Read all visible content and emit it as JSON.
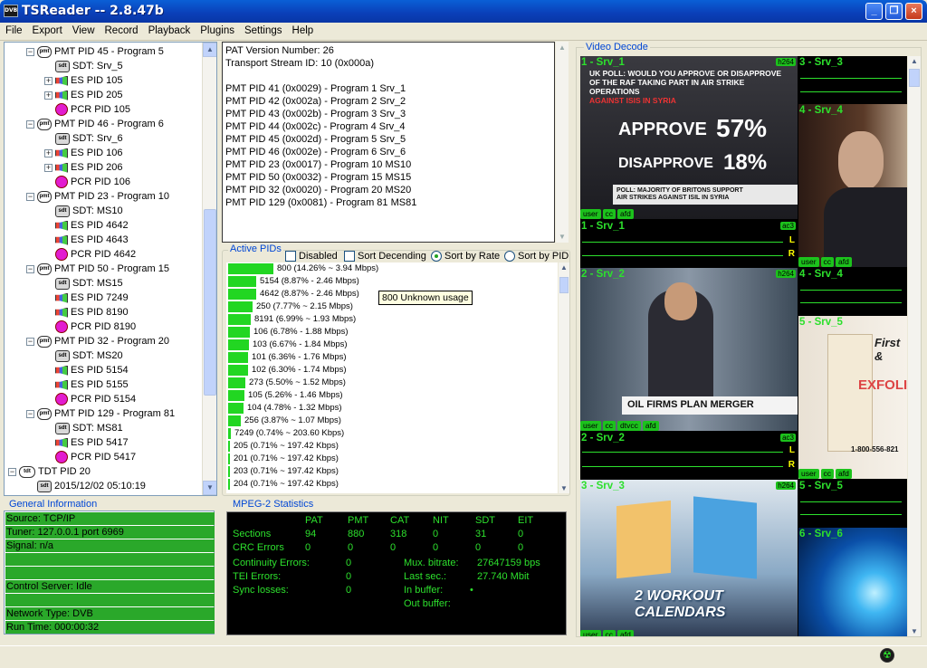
{
  "window": {
    "title": "TSReader -- 2.8.47b",
    "icon_text": "DVB",
    "minimize": "_",
    "maximize": "❐",
    "close": "×"
  },
  "menu": [
    "File",
    "Export",
    "View",
    "Record",
    "Playback",
    "Plugins",
    "Settings",
    "Help"
  ],
  "tree": [
    {
      "label": "PMT PID 45 - Program 5",
      "kind": "pmt",
      "level": 1
    },
    {
      "label": "SDT: Srv_5",
      "kind": "sdt",
      "level": 2
    },
    {
      "label": "ES PID 105",
      "kind": "es",
      "level": 2,
      "expand": true
    },
    {
      "label": "ES PID 205",
      "kind": "es",
      "level": 2,
      "expand": true
    },
    {
      "label": "PCR PID 105",
      "kind": "pcr",
      "level": 2
    },
    {
      "label": "PMT PID 46 - Program 6",
      "kind": "pmt",
      "level": 1
    },
    {
      "label": "SDT: Srv_6",
      "kind": "sdt",
      "level": 2
    },
    {
      "label": "ES PID 106",
      "kind": "es",
      "level": 2,
      "expand": true
    },
    {
      "label": "ES PID 206",
      "kind": "es",
      "level": 2,
      "expand": true
    },
    {
      "label": "PCR PID 106",
      "kind": "pcr",
      "level": 2
    },
    {
      "label": "PMT PID 23 - Program 10",
      "kind": "pmt",
      "level": 1
    },
    {
      "label": "SDT: MS10",
      "kind": "sdt",
      "level": 2
    },
    {
      "label": "ES PID 4642",
      "kind": "es",
      "level": 2
    },
    {
      "label": "ES PID 4643",
      "kind": "es",
      "level": 2
    },
    {
      "label": "PCR PID 4642",
      "kind": "pcr",
      "level": 2
    },
    {
      "label": "PMT PID 50 - Program 15",
      "kind": "pmt",
      "level": 1
    },
    {
      "label": "SDT: MS15",
      "kind": "sdt",
      "level": 2
    },
    {
      "label": "ES PID 7249",
      "kind": "es",
      "level": 2
    },
    {
      "label": "ES PID 8190",
      "kind": "es",
      "level": 2
    },
    {
      "label": "PCR PID 8190",
      "kind": "pcr",
      "level": 2
    },
    {
      "label": "PMT PID 32 - Program 20",
      "kind": "pmt",
      "level": 1
    },
    {
      "label": "SDT: MS20",
      "kind": "sdt",
      "level": 2
    },
    {
      "label": "ES PID 5154",
      "kind": "es",
      "level": 2
    },
    {
      "label": "ES PID 5155",
      "kind": "es",
      "level": 2
    },
    {
      "label": "PCR PID 5154",
      "kind": "pcr",
      "level": 2
    },
    {
      "label": "PMT PID 129 - Program 81",
      "kind": "pmt",
      "level": 1
    },
    {
      "label": "SDT: MS81",
      "kind": "sdt",
      "level": 2
    },
    {
      "label": "ES PID 5417",
      "kind": "es",
      "level": 2
    },
    {
      "label": "PCR PID 5417",
      "kind": "pcr",
      "level": 2
    },
    {
      "label": "TDT PID 20",
      "kind": "tdt",
      "level": 0
    },
    {
      "label": "2015/12/02 05:10:19",
      "kind": "sdt",
      "level": 1
    }
  ],
  "pat_lines": [
    "PAT Version Number: 26",
    "Transport Stream ID: 10 (0x000a)",
    "",
    "PMT PID 41 (0x0029) - Program 1 Srv_1",
    "PMT PID 42 (0x002a) - Program 2 Srv_2",
    "PMT PID 43 (0x002b) - Program 3 Srv_3",
    "PMT PID 44 (0x002c) - Program 4 Srv_4",
    "PMT PID 45 (0x002d) - Program 5 Srv_5",
    "PMT PID 46 (0x002e) - Program 6 Srv_6",
    "PMT PID 23 (0x0017) - Program 10 MS10",
    "PMT PID 50 (0x0032) - Program 15 MS15",
    "PMT PID 32 (0x0020) - Program 20 MS20",
    "PMT PID 129 (0x0081) - Program 81 MS81"
  ],
  "active_pids": {
    "legend": "Active PIDs",
    "disabled": "Disabled",
    "sort_desc": "Sort Decending",
    "sort_rate": "Sort by Rate",
    "sort_pid": "Sort by PID",
    "tooltip": "800 Unknown usage",
    "rows": [
      {
        "text": "800 (14.26% ~ 3.94 Mbps)",
        "pct": 14.26
      },
      {
        "text": "5154 (8.87% - 2.46 Mbps)",
        "pct": 8.87
      },
      {
        "text": "4642 (8.87% - 2.46 Mbps)",
        "pct": 8.87
      },
      {
        "text": "250 (7.77% ~ 2.15 Mbps)",
        "pct": 7.77
      },
      {
        "text": "8191 (6.99% ~ 1.93 Mbps)",
        "pct": 6.99
      },
      {
        "text": "106 (6.78% - 1.88 Mbps)",
        "pct": 6.78
      },
      {
        "text": "103 (6.67% - 1.84 Mbps)",
        "pct": 6.67
      },
      {
        "text": "101 (6.36% - 1.76 Mbps)",
        "pct": 6.36
      },
      {
        "text": "102 (6.30% - 1.74 Mbps)",
        "pct": 6.3
      },
      {
        "text": "273 (5.50% ~ 1.52 Mbps)",
        "pct": 5.5
      },
      {
        "text": "105 (5.26% - 1.46 Mbps)",
        "pct": 5.26
      },
      {
        "text": "104 (4.78% - 1.32 Mbps)",
        "pct": 4.78
      },
      {
        "text": "256 (3.87% ~ 1.07 Mbps)",
        "pct": 3.87
      },
      {
        "text": "7249 (0.74% ~ 203.60 Kbps)",
        "pct": 0.74
      },
      {
        "text": "205 (0.71% ~ 197.42 Kbps)",
        "pct": 0.71
      },
      {
        "text": "201 (0.71% ~ 197.42 Kbps)",
        "pct": 0.71
      },
      {
        "text": "203 (0.71% ~ 197.42 Kbps)",
        "pct": 0.71
      },
      {
        "text": "204 (0.71% ~ 197.42 Kbps)",
        "pct": 0.71
      }
    ]
  },
  "general_info": {
    "legend": "General Information",
    "rows": [
      "Source: TCP/IP",
      "Tuner: 127.0.0.1 port 6969",
      "Signal: n/a",
      "",
      "",
      "Control Server: Idle",
      "",
      "Network Type: DVB",
      "Run Time: 000:00:32"
    ]
  },
  "mpeg2": {
    "legend": "MPEG-2 Statistics",
    "headers": [
      "PAT",
      "PMT",
      "CAT",
      "NIT",
      "SDT",
      "EIT"
    ],
    "sections_label": "Sections",
    "sections": [
      "94",
      "880",
      "318",
      "0",
      "31",
      "0"
    ],
    "crc_label": "CRC Errors",
    "crc": [
      "0",
      "0",
      "0",
      "0",
      "0",
      "0"
    ],
    "cont_label": "Continuity Errors:",
    "cont": "0",
    "tei_label": "TEI Errors:",
    "tei": "0",
    "sync_label": "Sync losses:",
    "sync": "0",
    "mux_label": "Mux. bitrate:",
    "mux": "27647159 bps",
    "last_label": "Last sec.:",
    "last": "27.740 Mbit",
    "inbuf_label": "In buffer:",
    "inbuf": "•",
    "outbuf_label": "Out buffer:"
  },
  "video": {
    "legend": "Video Decode",
    "tiles": [
      {
        "label": "1 - Srv_1",
        "tag": "h264",
        "btns": [
          "user",
          "cc",
          "afd"
        ],
        "caption": [
          "UK POLL: WOULD YOU APPROVE OR DISAPPROVE",
          "OF THE RAF TAKING PART IN AIR STRIKE OPERATIONS",
          "AGAINST ISIS IN SYRIA"
        ],
        "approve": "APPROVE",
        "approve_pct": "57%",
        "disapprove": "DISAPPROVE",
        "disapprove_pct": "18%",
        "footer": [
          "POLL: MAJORITY OF BRITONS SUPPORT",
          "AIR STRIKES AGAINST ISIL IN SYRIA"
        ]
      },
      {
        "label": "1 - Srv_1",
        "tag": "ac3",
        "l": "L",
        "r": "R"
      },
      {
        "label": "2 - Srv_2",
        "tag": "h264",
        "btns": [
          "user",
          "cc",
          "dtvcc",
          "afd"
        ],
        "caption": "OIL FIRMS PLAN MERGER"
      },
      {
        "label": "2 - Srv_2",
        "tag": "ac3",
        "l": "L",
        "r": "R"
      },
      {
        "label": "3 - Srv_3",
        "tag": "h264",
        "btns": [
          "user",
          "cc",
          "afd"
        ],
        "caption": "2 WORKOUT CALENDARS"
      },
      {
        "label": "3 - Srv_3"
      },
      {
        "label": "4 - Srv_4",
        "btns": [
          "user",
          "cc",
          "afd"
        ]
      },
      {
        "label": "4 - Srv_4"
      },
      {
        "label": "5 - Srv_5",
        "btns": [
          "user",
          "cc",
          "afd"
        ],
        "brand": "First &",
        "product": "EXFOLI",
        "phone": "1-800-556-821"
      },
      {
        "label": "5 - Srv_5"
      },
      {
        "label": "6 - Srv_6"
      }
    ]
  },
  "status": {
    "icon": "☢"
  },
  "colors": {
    "accent_green": "#2de02d",
    "bar_green": "#22d622",
    "legend_blue": "#0046d5",
    "pcr_magenta": "#e21cd0"
  }
}
